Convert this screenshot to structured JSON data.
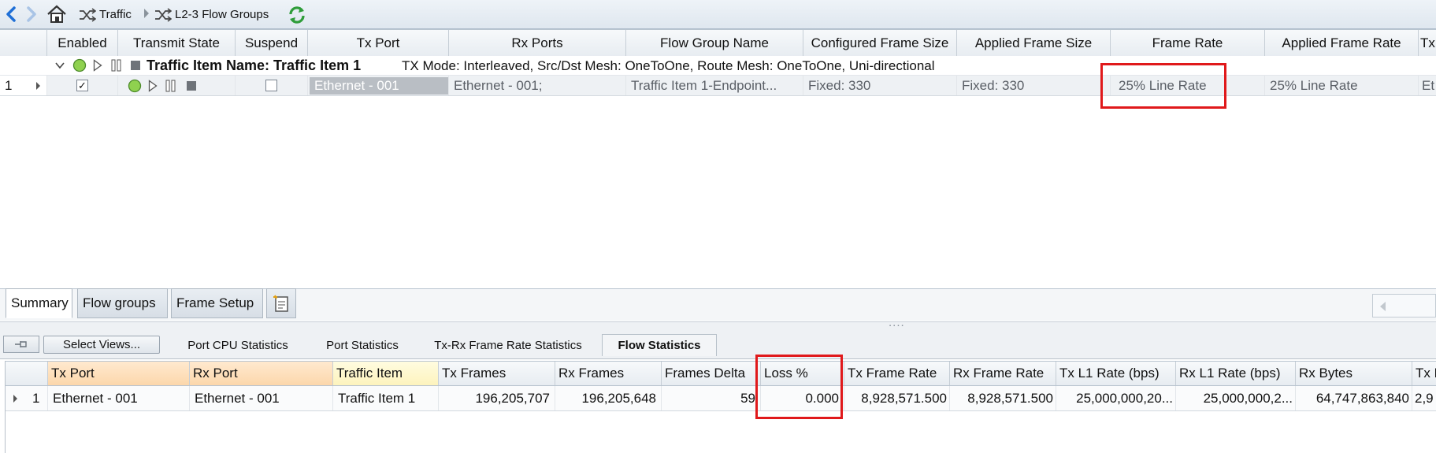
{
  "breadcrumb": {
    "back_icon": "back-arrow-icon",
    "forward_icon": "forward-arrow-icon",
    "home_icon": "home-icon",
    "items": [
      {
        "label": "Traffic",
        "icon": "traffic-shuffle-icon"
      },
      {
        "label": "L2-3 Flow Groups",
        "icon": "traffic-shuffle-icon"
      }
    ],
    "refresh_icon": "refresh-icon"
  },
  "flow_grid": {
    "columns": [
      "Enabled",
      "Transmit State",
      "Suspend",
      "Tx Port",
      "Rx Ports",
      "Flow Group Name",
      "Configured Frame Size",
      "Applied Frame Size",
      "Frame Rate",
      "Applied Frame Rate",
      "Tx"
    ],
    "group_row": {
      "label": "Traffic Item Name: Traffic Item 1",
      "details": "TX Mode: Interleaved, Src/Dst Mesh: OneToOne, Route Mesh: OneToOne, Uni-directional"
    },
    "row": {
      "index": "1",
      "enabled": true,
      "suspend": false,
      "tx_port": "Ethernet - 001",
      "rx_ports": "Ethernet - 001;",
      "flow_group_name": "Traffic Item 1-Endpoint...",
      "configured_frame_size": "Fixed: 330",
      "applied_frame_size": "Fixed: 330",
      "frame_rate": "25% Line Rate",
      "applied_frame_rate": "25% Line Rate",
      "tx_trunc": "Et"
    }
  },
  "tabs": [
    "Summary",
    "Flow groups",
    "Frame Setup"
  ],
  "tabs_active": "Summary",
  "splitter_grip": "....",
  "stats": {
    "select_views_label": "Select Views...",
    "tabs": [
      "Port CPU Statistics",
      "Port Statistics",
      "Tx-Rx Frame Rate Statistics",
      "Flow Statistics"
    ],
    "active_tab": "Flow Statistics",
    "columns": [
      "Tx Port",
      "Rx Port",
      "Traffic Item",
      "Tx Frames",
      "Rx Frames",
      "Frames Delta",
      "Loss %",
      "Tx Frame Rate",
      "Rx Frame Rate",
      "Tx L1 Rate (bps)",
      "Rx L1 Rate (bps)",
      "Rx Bytes",
      "Tx R"
    ],
    "row": {
      "index": "1",
      "tx_port": "Ethernet - 001",
      "rx_port": "Ethernet - 001",
      "traffic_item": "Traffic Item 1",
      "tx_frames": "196,205,707",
      "rx_frames": "196,205,648",
      "frames_delta": "59",
      "loss_pct": "0.000",
      "tx_frame_rate": "8,928,571.500",
      "rx_frame_rate": "8,928,571.500",
      "tx_l1_rate": "25,000,000,20...",
      "rx_l1_rate": "25,000,000,2...",
      "rx_bytes": "64,747,863,840",
      "tx_r_trunc": "2,9"
    }
  },
  "colors": {
    "highlight": "#e0191b",
    "accent_blue": "#1f6fd6"
  }
}
